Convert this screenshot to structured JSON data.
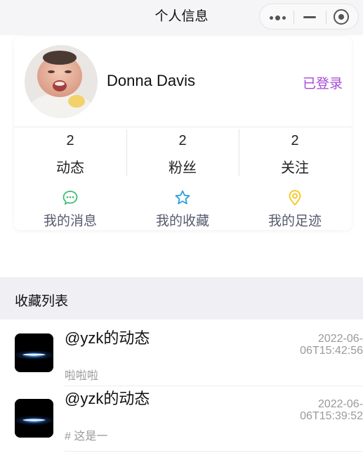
{
  "nav": {
    "title": "个人信息",
    "capsule_icons": [
      "more-dots-icon",
      "minimize-icon",
      "close-target-icon"
    ]
  },
  "profile": {
    "name": "Donna Davis",
    "status": "已登录",
    "status_color": "#a64ad6",
    "stats": [
      {
        "count": "2",
        "label": "动态"
      },
      {
        "count": "2",
        "label": "粉丝"
      },
      {
        "count": "2",
        "label": "关注"
      }
    ],
    "actions": [
      {
        "label": "我的消息",
        "icon": "message-bubble-icon",
        "color": "#3dbf73"
      },
      {
        "label": "我的收藏",
        "icon": "star-icon",
        "color": "#2aa0d8"
      },
      {
        "label": "我的足迹",
        "icon": "location-pin-icon",
        "color": "#f5c518"
      }
    ]
  },
  "favorites": {
    "title": "收藏列表",
    "items": [
      {
        "title": "@yzk的动态",
        "time_line1": "2022-06-",
        "time_line2": "06T15:42:56",
        "desc": "啦啦啦"
      },
      {
        "title": "@yzk的动态",
        "time_line1": "2022-06-",
        "time_line2": "06T15:39:52",
        "desc": "# 这是一"
      }
    ]
  }
}
